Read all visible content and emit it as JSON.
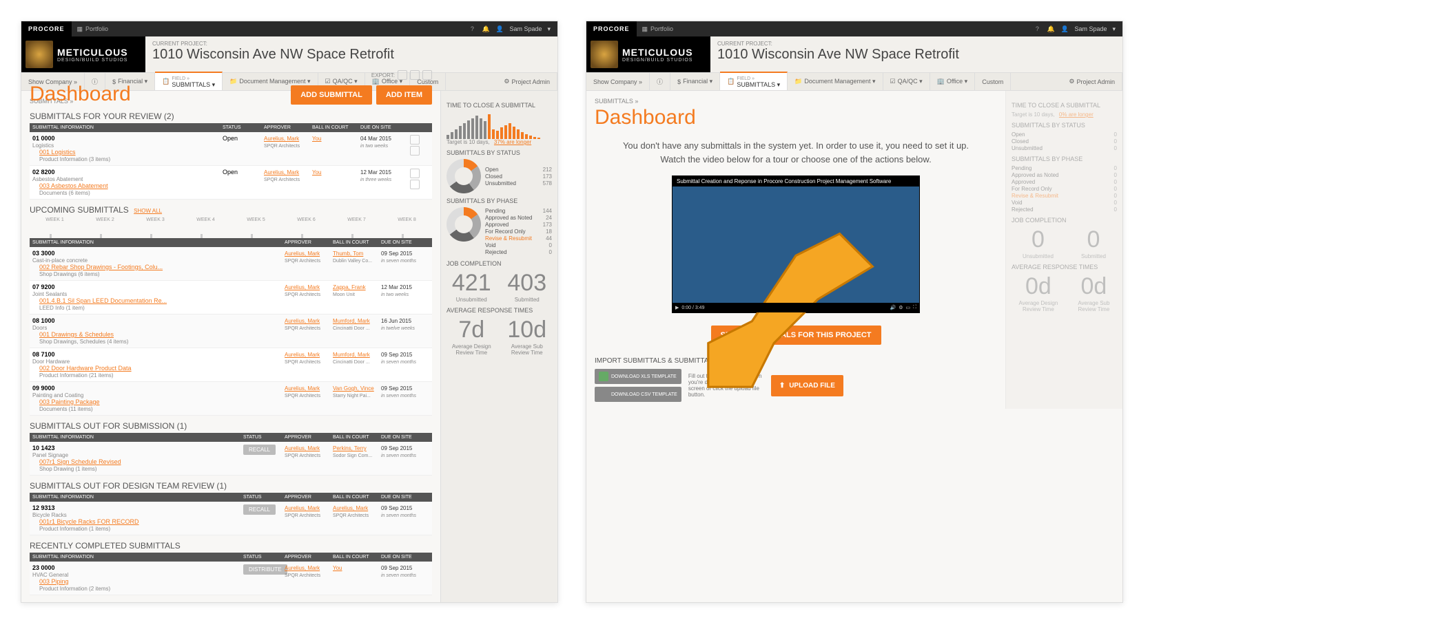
{
  "topbar": {
    "logo": "PROCORE",
    "portfolio": "Portfolio",
    "user": "Sam Spade"
  },
  "brand": {
    "name": "METICULOUS",
    "sub": "DESIGN/BUILD STUDIOS"
  },
  "project": {
    "label": "CURRENT PROJECT:",
    "name": "1010 Wisconsin Ave NW Space Retrofit"
  },
  "nav": {
    "show": "Show Company »",
    "financial": "Financial ▾",
    "field": "FIELD »",
    "submittals": "SUBMITTALS ▾",
    "docmgmt": "Document Management ▾",
    "qaqc": "QA/QC ▾",
    "office": "Office ▾",
    "custom": "Custom",
    "admin": "Project Admin"
  },
  "crumb": "SUBMITTALS »",
  "title": "Dashboard",
  "export": "EXPORT:",
  "buttons": {
    "add_submittal": "ADD SUBMITTAL",
    "add_item": "ADD ITEM",
    "recall": "RECALL",
    "distribute": "DISTRIBUTE"
  },
  "sections": {
    "review": "SUBMITTALS FOR YOUR REVIEW (2)",
    "upcoming": "UPCOMING SUBMITTALS",
    "showall": "Show all",
    "out_sub": "SUBMITTALS OUT FOR SUBMISSION (1)",
    "out_design": "SUBMITTALS OUT FOR DESIGN TEAM REVIEW (1)",
    "recent": "RECENTLY COMPLETED SUBMITTALS"
  },
  "cols": {
    "info": "SUBMITTAL INFORMATION",
    "status": "STATUS",
    "appr": "APPROVER",
    "ball": "BALL IN COURT",
    "due": "DUE ON SITE"
  },
  "weeks": [
    "WEEK 1",
    "WEEK 2",
    "WEEK 3",
    "WEEK 4",
    "WEEK 5",
    "WEEK 6",
    "WEEK 7",
    "WEEK 8"
  ],
  "review_rows": [
    {
      "code": "01 0000",
      "cat": "Logistics",
      "link": "001 Logistics",
      "sub": "Product Information (3 items)",
      "status": "Open",
      "appr": "Aurelius, Mark",
      "appr_sub": "SPQR Architects",
      "ball": "You",
      "due": "04 Mar 2015",
      "due_sub": "in two weeks"
    },
    {
      "code": "02 8200",
      "cat": "Asbestos Abatement",
      "link": "003 Asbestos Abatement",
      "sub": "Documents (6 items)",
      "status": "Open",
      "appr": "Aurelius, Mark",
      "appr_sub": "SPQR Architects",
      "ball": "You",
      "due": "12 Mar 2015",
      "due_sub": "in three weeks"
    }
  ],
  "upcoming_rows": [
    {
      "code": "03 3000",
      "cat": "Cast-in-place concrete",
      "link": "002 Rebar Shop Drawings - Footings, Colu...",
      "sub": "Shop Drawings (6 items)",
      "appr": "Aurelius, Mark",
      "appr_sub": "SPQR Architects",
      "ball": "Thumb, Tom",
      "ball_sub": "Dublin Valley Co...",
      "due": "09 Sep 2015",
      "due_sub": "in seven months"
    },
    {
      "code": "07 9200",
      "cat": "Joint Sealants",
      "link": "001.4.B.1 Sil Span LEED Documentation Re...",
      "sub": "LEED Info (1 item)",
      "appr": "Aurelius, Mark",
      "appr_sub": "SPQR Architects",
      "ball": "Zappa, Frank",
      "ball_sub": "Moon Unit",
      "due": "12 Mar 2015",
      "due_sub": "in two weeks"
    },
    {
      "code": "08 1000",
      "cat": "Doors",
      "link": "001 Drawings & Schedules",
      "sub": "Shop Drawings, Schedules (4 items)",
      "appr": "Aurelius, Mark",
      "appr_sub": "SPQR Architects",
      "ball": "Mumford, Mark",
      "ball_sub": "Cincinatti Door ...",
      "due": "16 Jun 2015",
      "due_sub": "in twelve weeks"
    },
    {
      "code": "08 7100",
      "cat": "Door Hardware",
      "link": "002 Door Hardware Product Data",
      "sub": "Product Information (21 items)",
      "appr": "Aurelius, Mark",
      "appr_sub": "SPQR Architects",
      "ball": "Mumford, Mark",
      "ball_sub": "Cincinatti Door ...",
      "due": "09 Sep 2015",
      "due_sub": "in seven months"
    },
    {
      "code": "09 9000",
      "cat": "Painting and Coating",
      "link": "003 Painting Package",
      "sub": "Documents (11 items)",
      "appr": "Aurelius, Mark",
      "appr_sub": "SPQR Architects",
      "ball": "Van Gogh, Vince",
      "ball_sub": "Starry Night Pai...",
      "due": "09 Sep 2015",
      "due_sub": "in seven months"
    }
  ],
  "out_sub_rows": [
    {
      "code": "10 1423",
      "cat": "Panel Signage",
      "link": "007r1 Sign Schedule Revised",
      "sub": "Shop Drawing (1 items)",
      "appr": "Aurelius, Mark",
      "appr_sub": "SPQR Architects",
      "ball": "Perkins, Terry",
      "ball_sub": "Sodor Sign Com...",
      "due": "09 Sep 2015",
      "due_sub": "in seven months"
    }
  ],
  "out_design_rows": [
    {
      "code": "12 9313",
      "cat": "Bicycle Racks",
      "link": "001r1 Bicycle Racks FOR RECORD",
      "sub": "Product Information (1 items)",
      "appr": "Aurelius, Mark",
      "appr_sub": "SPQR Architects",
      "ball": "Aurelius, Mark",
      "ball_sub": "SPQR Architects",
      "due": "09 Sep 2015",
      "due_sub": "in seven months"
    }
  ],
  "recent_rows": [
    {
      "code": "23 0000",
      "cat": "HVAC General",
      "link": "003 Piping",
      "sub": "Product Information (2 items)",
      "appr": "Aurelius, Mark",
      "appr_sub": "SPQR Architects",
      "ball": "You",
      "due": "09 Sep 2015",
      "due_sub": "in seven months"
    }
  ],
  "side": {
    "close_h": "TIME TO CLOSE A SUBMITTAL",
    "close_note": "Target is 10 days, ",
    "close_link": "37% are longer",
    "status_h": "SUBMITTALS BY STATUS",
    "status_rows": [
      [
        "Open",
        "212"
      ],
      [
        "Closed",
        "173"
      ],
      [
        "Unsubmitted",
        "578"
      ]
    ],
    "phase_h": "SUBMITTALS BY PHASE",
    "phase_rows": [
      [
        "Pending",
        "144"
      ],
      [
        "Approved as Noted",
        "24"
      ],
      [
        "Approved",
        "173"
      ],
      [
        "For Record Only",
        "18"
      ],
      [
        "Revise & Resubmit",
        "44"
      ],
      [
        "Void",
        "0"
      ],
      [
        "Rejected",
        "0"
      ]
    ],
    "job_h": "JOB COMPLETION",
    "unsub": "421",
    "unsub_l": "Unsubmitted",
    "sub": "403",
    "sub_l": "Submitted",
    "resp_h": "AVERAGE RESPONSE TIMES",
    "d1": "7d",
    "d1_l1": "Average Design",
    "d1_l2": "Review Time",
    "d2": "10d",
    "d2_l1": "Average Sub",
    "d2_l2": "Review Time"
  },
  "empty": {
    "msg": "You don't have any submittals in the system yet. In order to use it, you need to set it up. Watch the video below for a tour or choose one of the actions below.",
    "video_title": "Submittal Creation and Reponse in Procore Construction Project Management Software",
    "video_time": "0:00 / 3:49",
    "setup": "SETUP SUBMITTALS FOR THIS PROJECT",
    "import_h": "IMPORT SUBMITTALS & SUBMITTAL ITEMS",
    "xls": "DOWNLOAD XLS TEMPLATE",
    "csv": "DOWNLOAD CSV TEMPLATE",
    "help": "Fill out the template and when you're done, drag it to the screen or click the upload file button.",
    "upload": "UPLOAD FILE"
  },
  "side_empty": {
    "close_note": "Target is 10 days, ",
    "close_link": "0% are longer",
    "status_rows": [
      [
        "Open",
        "0"
      ],
      [
        "Closed",
        "0"
      ],
      [
        "Unsubmitted",
        "0"
      ]
    ],
    "phase_rows": [
      [
        "Pending",
        "0"
      ],
      [
        "Approved as Noted",
        "0"
      ],
      [
        "Approved",
        "0"
      ],
      [
        "For Record Only",
        "0"
      ],
      [
        "Revise & Resubmit",
        "0"
      ],
      [
        "Void",
        "0"
      ],
      [
        "Rejected",
        "0"
      ]
    ],
    "unsub": "0",
    "sub": "0",
    "d1": "0d",
    "d2": "0d"
  },
  "chart_data": {
    "type": "bar",
    "title": "Time to close a submittal",
    "values": [
      6,
      10,
      14,
      19,
      23,
      27,
      30,
      34,
      30,
      26,
      36,
      14,
      12,
      17,
      20,
      23,
      18,
      14,
      10,
      7,
      5,
      3,
      2
    ],
    "threshold_index": 10,
    "note": "bars after threshold colored orange (over 10-day target)"
  }
}
